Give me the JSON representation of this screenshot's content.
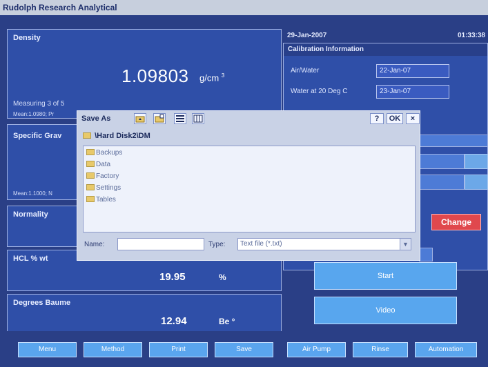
{
  "app": {
    "title": "Rudolph Research Analytical"
  },
  "density": {
    "title": "Density",
    "value": "1.09803",
    "unit": "g/cm",
    "unit_exp": "3",
    "status": "Measuring 3 of 5",
    "mean": "Mean:1.0980; Pr"
  },
  "specific_gravity": {
    "title": "Specific Grav",
    "mean": "Mean:1.1000; N"
  },
  "normality": {
    "title": "Normality"
  },
  "hcl": {
    "title": "HCL % wt",
    "value": "19.95",
    "unit": "%"
  },
  "baume": {
    "title": "Degrees Baume",
    "value": "12.94",
    "unit": "Be °"
  },
  "calibration": {
    "date": "29-Jan-2007",
    "time": "01:33:38",
    "title": "Calibration Information",
    "air_water_label": "Air/Water",
    "air_water_value": "22-Jan-07",
    "water20_label": "Water at 20 Deg C",
    "water20_value": "23-Jan-07"
  },
  "controls": {
    "change": "Change",
    "start": "Start",
    "video": "Video"
  },
  "bottom_nav": {
    "menu": "Menu",
    "method": "Method",
    "print": "Print",
    "save": "Save",
    "air_pump": "Air Pump",
    "rinse": "Rinse",
    "automation": "Automation"
  },
  "dialog": {
    "title": "Save As",
    "help": "?",
    "ok": "OK",
    "close": "×",
    "path": "\\Hard Disk2\\DM",
    "folders": [
      "Backups",
      "Data",
      "Factory",
      "Settings",
      "Tables"
    ],
    "name_label": "Name:",
    "name_value": "",
    "type_label": "Type:",
    "type_value": "Text file (*.txt)"
  },
  "colors": {
    "background": "#2a3f86",
    "panel": "#2f4fa8",
    "change_button": "#e0484d",
    "action_button": "#58a6ee",
    "dialog": "#c9d2e6"
  },
  "icons": {
    "folder": "folder-icon",
    "up": "up-folder-icon",
    "new_folder": "new-folder-icon",
    "list_view": "list-view-icon",
    "detail_view": "detail-view-icon",
    "path": "drive-icon"
  }
}
